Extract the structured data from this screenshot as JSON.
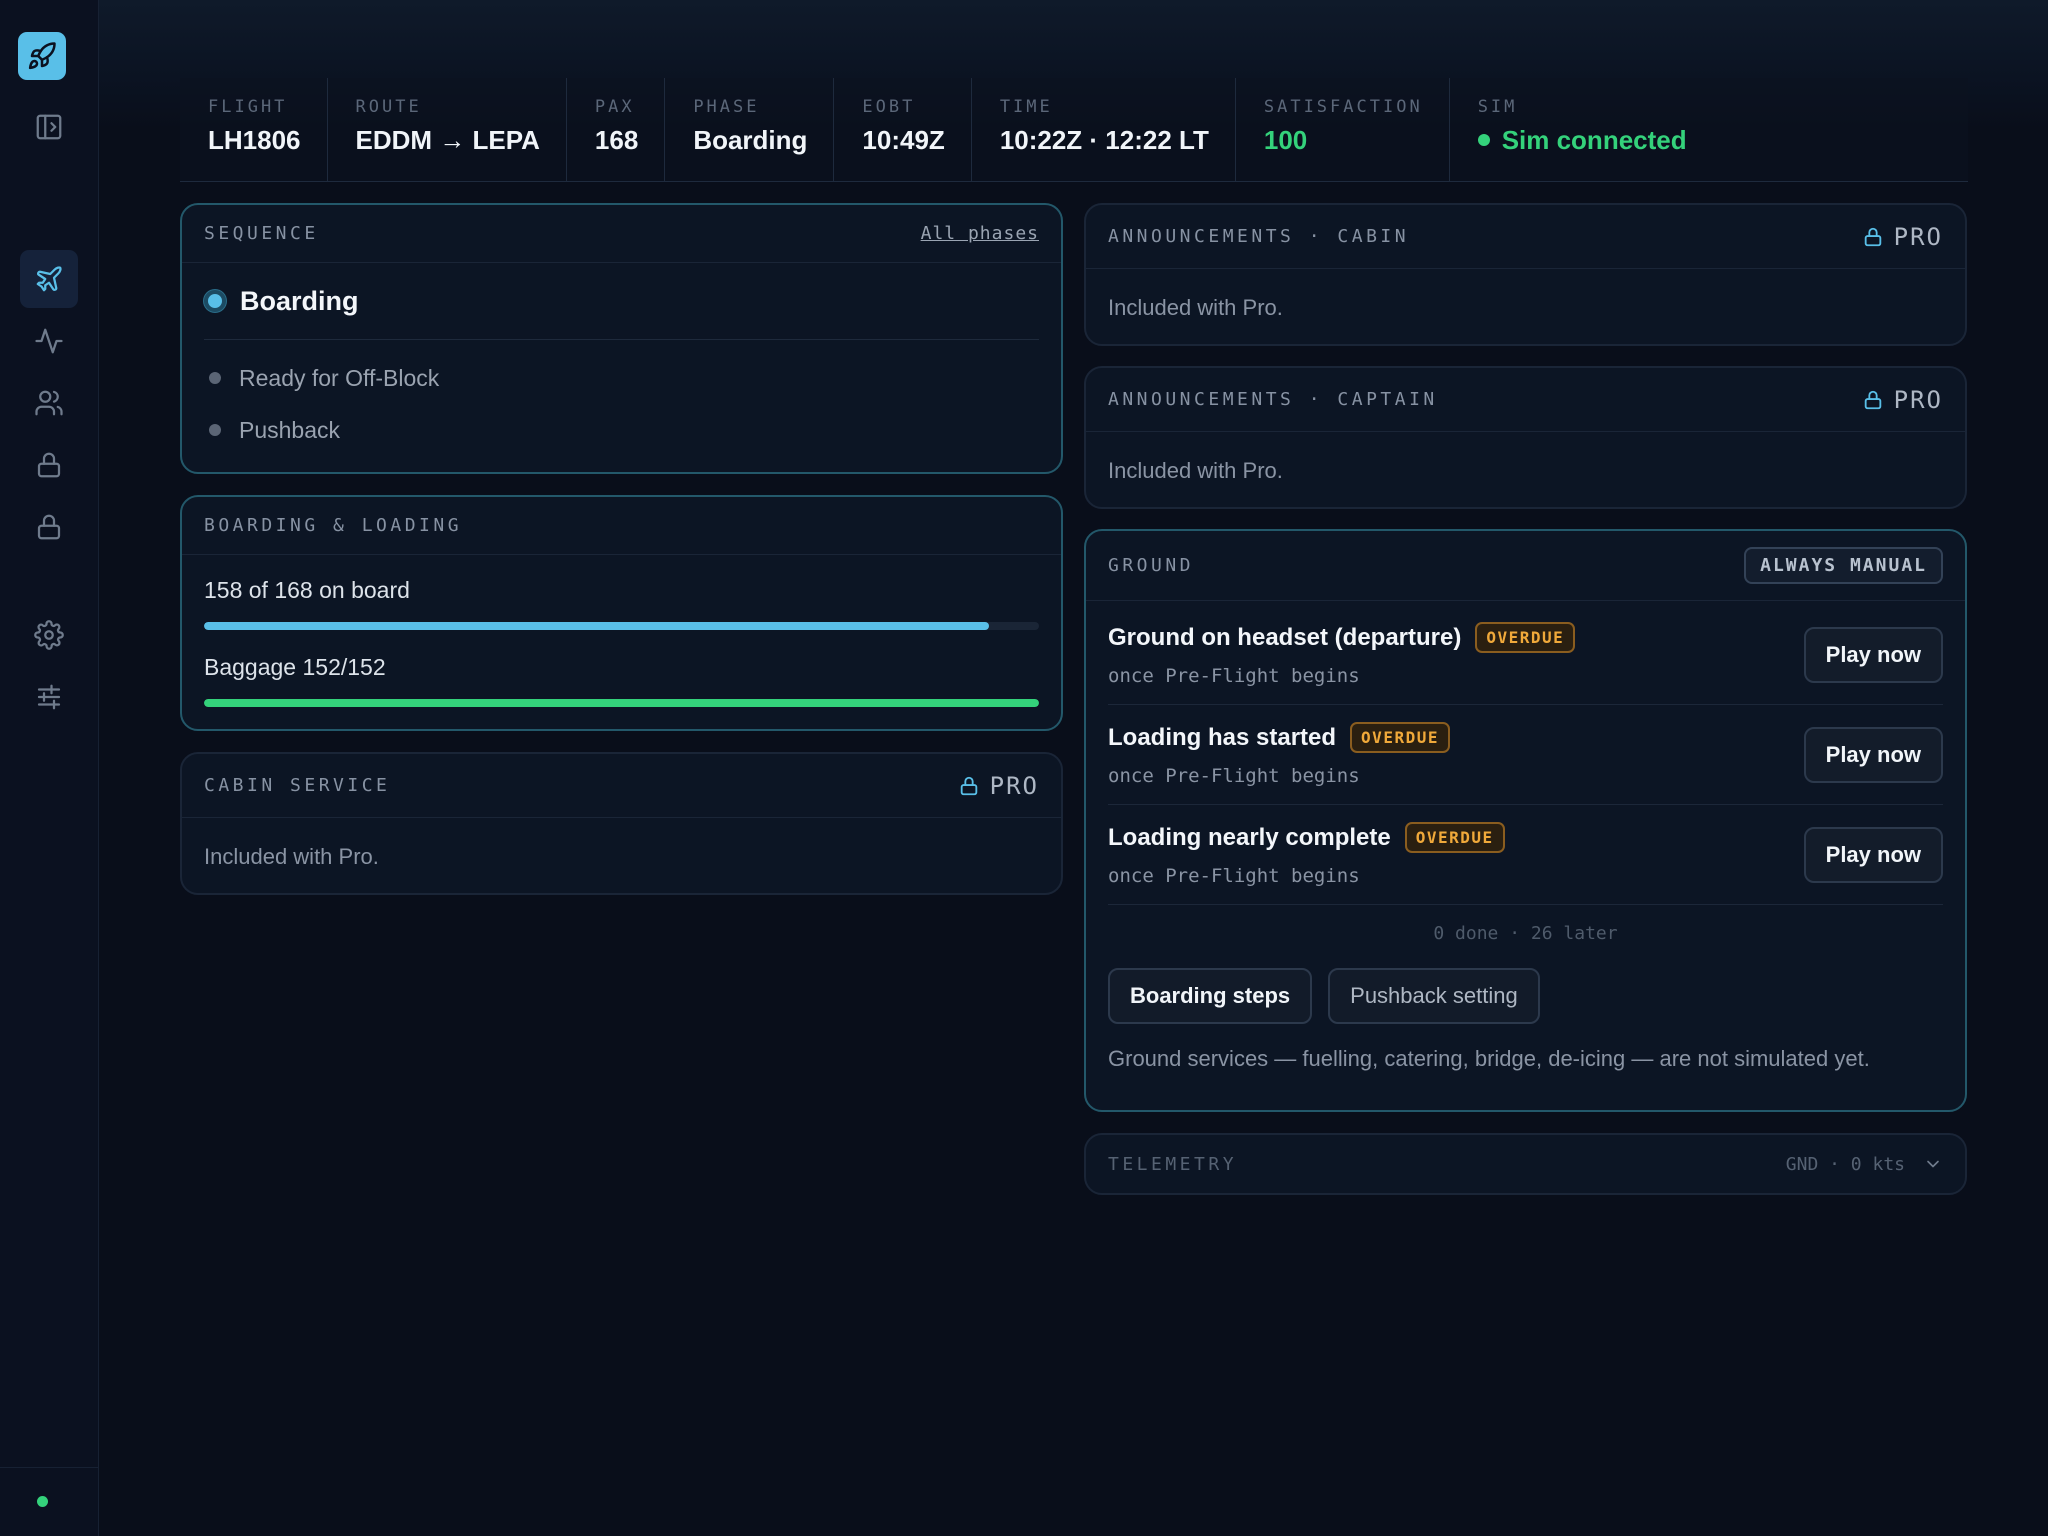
{
  "sidebar": {
    "logo_icon": "rocket-icon",
    "items": [
      {
        "name": "panel-toggle",
        "icon": "sidebar-toggle-icon"
      },
      {
        "name": "flight",
        "icon": "plane-icon",
        "active": true
      },
      {
        "name": "activity",
        "icon": "activity-icon"
      },
      {
        "name": "crew",
        "icon": "users-icon"
      },
      {
        "name": "locked-1",
        "icon": "lock-icon"
      },
      {
        "name": "locked-2",
        "icon": "lock-icon"
      },
      {
        "name": "settings",
        "icon": "gear-icon"
      },
      {
        "name": "adjust",
        "icon": "sliders-icon"
      }
    ],
    "status_color": "#34d27b"
  },
  "status": {
    "flight": {
      "label": "FLIGHT",
      "value": "LH1806"
    },
    "route": {
      "label": "ROUTE",
      "value": "EDDM → LEPA"
    },
    "pax": {
      "label": "PAX",
      "value": "168"
    },
    "phase": {
      "label": "PHASE",
      "value": "Boarding"
    },
    "eobt": {
      "label": "EOBT",
      "value": "10:49Z"
    },
    "time": {
      "label": "TIME",
      "value": "10:22Z · 12:22 LT"
    },
    "satisfaction": {
      "label": "SATISFACTION",
      "value": "100"
    },
    "sim": {
      "label": "SIM",
      "value": "Sim connected"
    }
  },
  "sequence": {
    "title": "SEQUENCE",
    "link": "All phases",
    "current": "Boarding",
    "upcoming": [
      "Ready for Off-Block",
      "Pushback"
    ]
  },
  "boarding": {
    "title": "BOARDING & LOADING",
    "pax_label": "158 of 168 on board",
    "pax_progress": 0.94,
    "baggage_label": "Baggage 152/152",
    "baggage_progress": 1.0
  },
  "cabin_service": {
    "title": "CABIN SERVICE",
    "badge": "PRO",
    "body": "Included with Pro."
  },
  "ann_cabin": {
    "title": "ANNOUNCEMENTS · CABIN",
    "badge": "PRO",
    "body": "Included with Pro."
  },
  "ann_captain": {
    "title": "ANNOUNCEMENTS · CAPTAIN",
    "badge": "PRO",
    "body": "Included with Pro."
  },
  "ground": {
    "title": "GROUND",
    "badge": "ALWAYS MANUAL",
    "items": [
      {
        "title": "Ground on headset (departure)",
        "status": "OVERDUE",
        "sub": "once Pre-Flight begins",
        "action": "Play now"
      },
      {
        "title": "Loading has started",
        "status": "OVERDUE",
        "sub": "once Pre-Flight begins",
        "action": "Play now"
      },
      {
        "title": "Loading nearly complete",
        "status": "OVERDUE",
        "sub": "once Pre-Flight begins",
        "action": "Play now"
      }
    ],
    "counts": "0 done · 26 later",
    "btn_boarding": "Boarding steps",
    "btn_pushback": "Pushback setting",
    "note": "Ground services — fuelling, catering, bridge, de-icing — are not simulated yet."
  },
  "telemetry": {
    "title": "TELEMETRY",
    "summary": "GND · 0 kts",
    "icon": "chevron-down-icon"
  },
  "colors": {
    "accent": "#59bfe8",
    "success": "#34d27b",
    "warning": "#f0a93a",
    "background": "#090e1a"
  }
}
